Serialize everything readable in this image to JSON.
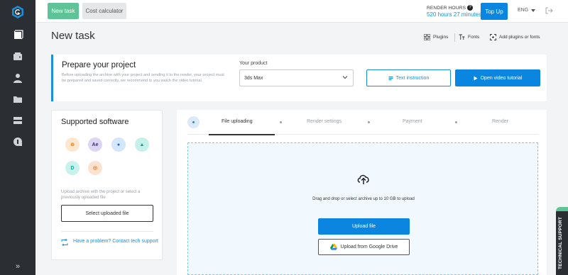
{
  "sidebar": {
    "items": [
      "cube-icon",
      "wallet-icon",
      "user-icon",
      "folder-icon",
      "server-icon",
      "knowledge-icon"
    ],
    "expand_label": "»"
  },
  "topbar": {
    "new_task_label": "New task",
    "cost_calculator_label": "Cost calculator",
    "render_hours_label": "RENDER HOURS",
    "render_hours_value": "520 hours 27 minutes",
    "top_up_label": "Top Up",
    "language": "ENG"
  },
  "page": {
    "title": "New task",
    "tools": {
      "plugins": "Plugins",
      "fonts": "Fonts",
      "add_plugins": "Add plugins or fonts"
    }
  },
  "prepare": {
    "title": "Prepare your project",
    "description": "Before uploading the archive with your project and sending it to the render, your project must be prepared and saved correctly, we recommend to you watch the video tutorial.",
    "product_label": "Your product",
    "product_value": "3ds Max",
    "text_instruction_label": "Text instruction",
    "video_tutorial_label": "Open video tutorial"
  },
  "software": {
    "title": "Supported software",
    "icons": [
      {
        "name": "blender-icon",
        "color": "#fde7cf",
        "fg": "#f08a24",
        "glyph": "⊕"
      },
      {
        "name": "after-effects-icon",
        "color": "#ddd6f3",
        "fg": "#3a2f7a",
        "glyph": "Ae"
      },
      {
        "name": "cinema4d-icon",
        "color": "#d3e6fb",
        "fg": "#1c65c8",
        "glyph": "●"
      },
      {
        "name": "houdini-icon",
        "color": "#c6f1ea",
        "fg": "#1a9c8a",
        "glyph": "▲"
      },
      {
        "name": "dimension-icon",
        "color": "#c9f2ec",
        "fg": "#14a892",
        "glyph": "D"
      },
      {
        "name": "corona-icon",
        "color": "#fde3cf",
        "fg": "#e67a2e",
        "glyph": "◎"
      }
    ],
    "hint": "Upload archive with the project or select a previously uploaded file",
    "select_uploaded_label": "Select uploaded file",
    "help_label": "Have a problem? Contact tech support"
  },
  "steps": [
    "File uploading",
    "Render settings",
    "Payment",
    "Render"
  ],
  "upload": {
    "dropzone_text": "Drag and drop or select archive up to 10 GB to upload",
    "upload_button": "Upload file",
    "gdrive_button": "Upload from Google Drive"
  },
  "tech_support_label": "TECHNICAL SUPPORT",
  "colors": {
    "accent_blue": "#0a86e0",
    "green": "#5ec396",
    "sidebar": "#2b2e33"
  }
}
